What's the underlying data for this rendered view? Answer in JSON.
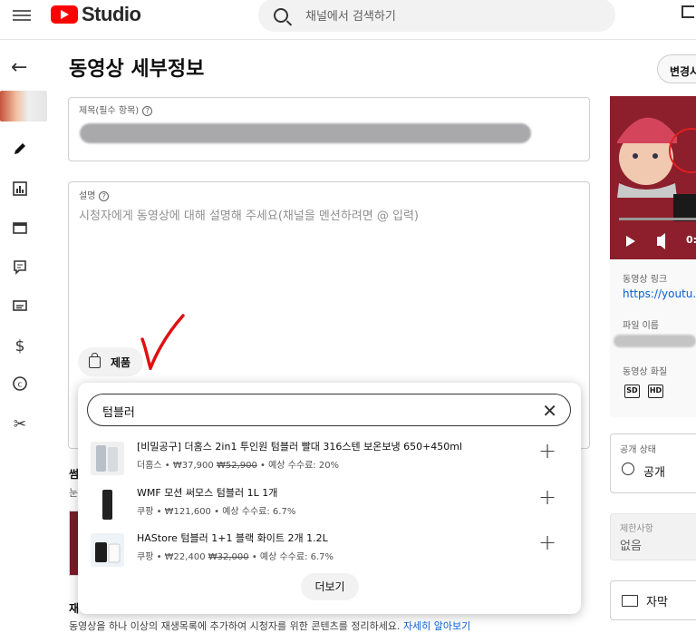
{
  "header": {
    "logo_text": "Studio",
    "search_placeholder": "채널에서 검색하기"
  },
  "page": {
    "title": "동영상 세부정보",
    "change_button": "변경사"
  },
  "title_field": {
    "label": "제목(필수 항목)"
  },
  "description_field": {
    "label": "설명",
    "placeholder": "시청자에게 동영상에 대해 설명해 주세요(채널을 멘션하려면 @ 입력)",
    "product_chip": "제품"
  },
  "product_search": {
    "query": "텀블러",
    "more_button": "더보기",
    "products": [
      {
        "name": "[비밀공구] 더홈스 2in1 투인원 텀블러 빨대 316스텐 보온보냉 650+450ml",
        "seller": "더홈스",
        "price": "₩37,900",
        "original_price": "₩52,900",
        "commission": "예상 수수료: 20%"
      },
      {
        "name": "WMF 모션 써모스 텀블러 1L 1개",
        "seller": "쿠팡",
        "price": "₩121,600",
        "original_price": "",
        "commission": "예상 수수료: 6.7%"
      },
      {
        "name": "HAStore 텀블러 1+1 블랙 화이트 2개 1.2L",
        "seller": "쿠팡",
        "price": "₩22,400",
        "original_price": "₩32,000",
        "commission": "예상 수수료: 6.7%"
      }
    ]
  },
  "right_panel": {
    "video_link_label": "동영상 링크",
    "video_link": "https://youtu.",
    "filename_label": "파일 이름",
    "quality_label": "동영상 화질",
    "quality_badges": [
      "SD",
      "HD"
    ],
    "visibility_label": "공개 상태",
    "visibility_value": "공개",
    "restrictions_label": "제한사항",
    "restrictions_value": "없음",
    "subtitles_label": "자막",
    "thumbnail_time": "0:"
  },
  "left_partial": {
    "thumb_heading": "썸",
    "thumb_sub": "눈",
    "playlist_heading": "재",
    "playlist_text": "동영상을 하나 이상의 재생목록에 추가하여 시청자를 위한 콘텐츠를 정리하세요.",
    "learn_more": "자세히 알아보기"
  },
  "icons": {
    "menu": "hamburger-icon",
    "search": "search-icon",
    "back": "back-arrow-icon",
    "edit": "pencil-icon",
    "analytics": "analytics-icon",
    "editor": "clapperboard-icon",
    "comments": "comment-icon",
    "subtitles": "subtitles-icon",
    "earn": "dollar-icon",
    "copyright": "copyright-icon",
    "clips": "scissors-icon",
    "globe": "globe-icon"
  }
}
